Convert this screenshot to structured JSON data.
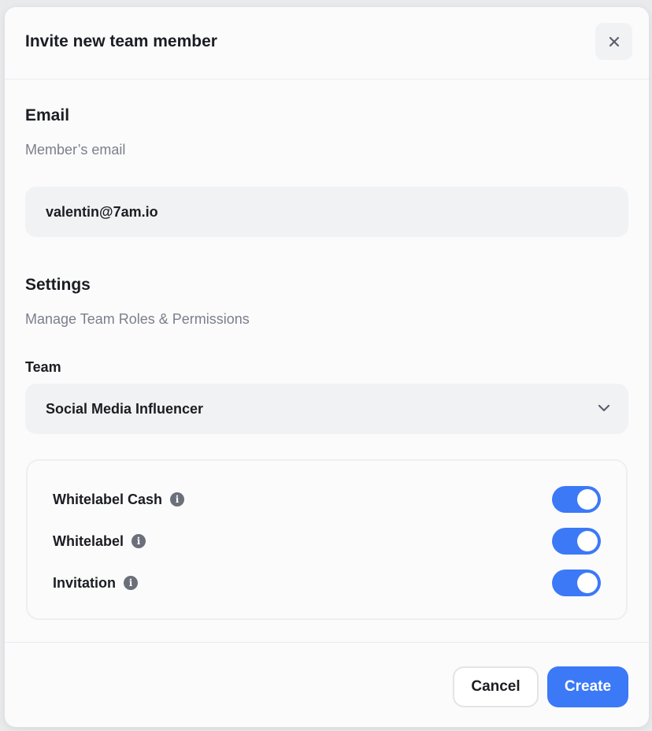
{
  "modal": {
    "title": "Invite new team member"
  },
  "email_section": {
    "title": "Email",
    "subtitle": "Member’s email",
    "value": "valentin@7am.io"
  },
  "settings_section": {
    "title": "Settings",
    "subtitle": "Manage Team Roles & Permissions",
    "team_label": "Team",
    "team_value": "Social Media Influencer"
  },
  "permissions": [
    {
      "label": "Whitelabel Cash",
      "enabled": true
    },
    {
      "label": "Whitelabel",
      "enabled": true
    },
    {
      "label": "Invitation",
      "enabled": true
    }
  ],
  "footer": {
    "cancel_label": "Cancel",
    "create_label": "Create"
  },
  "icons": {
    "close": "close-icon",
    "chevron": "chevron-down-icon",
    "info": "info-icon"
  },
  "colors": {
    "accent": "#3b79f7",
    "muted_text": "#7b7f8a",
    "field_bg": "#f1f2f4"
  }
}
